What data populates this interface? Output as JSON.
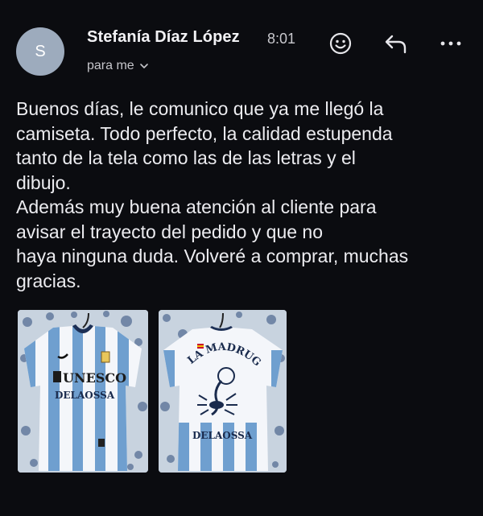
{
  "sender": {
    "avatar_initial": "S",
    "name": "Stefanía Díaz López",
    "time": "8:01",
    "recipient": "para me"
  },
  "actions": {
    "emoji_icon": "smiley-face-icon",
    "reply_icon": "reply-arrow-icon",
    "more_icon": "more-horizontal-icon"
  },
  "message": {
    "body": "Buenos días, le comunico que ya me llegó la\ncamiseta. Todo perfecto, la calidad estupenda\ntanto de la tela como las de las letras y el\ndibujo.\nAdemás muy buena atención al cliente para\navisar el trayecto del pedido y que no\nhaya ninguna duda. Volveré a comprar, muchas\ngracias."
  },
  "attachments": [
    {
      "kind": "photo",
      "jersey_side": "front",
      "sponsor_text": "UNESCO",
      "name_text": "DELAOSSA"
    },
    {
      "kind": "photo",
      "jersey_side": "back",
      "arc_text": "LA MADRUGÁ",
      "name_text": "DELAOSSA"
    }
  ],
  "colors": {
    "background": "#0b0c10",
    "text": "#ececf0",
    "avatar": "#9dabbd",
    "jersey_stripe": "#6f9fcf",
    "jersey_white": "#f4f6fa"
  }
}
